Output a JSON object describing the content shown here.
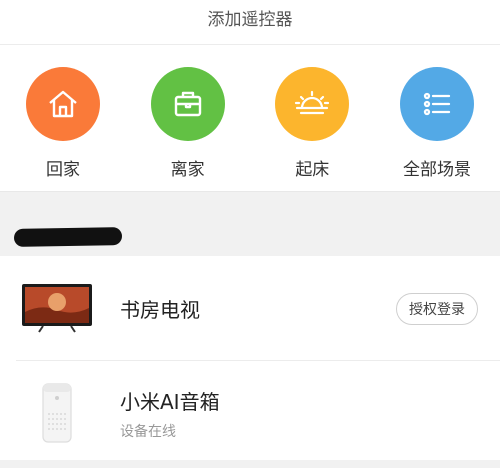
{
  "header": {
    "title": "添加遥控器"
  },
  "scenes": [
    {
      "label": "回家",
      "icon": "home-icon",
      "color": "#fa7a39"
    },
    {
      "label": "离家",
      "icon": "briefcase-icon",
      "color": "#62c144"
    },
    {
      "label": "起床",
      "icon": "sunrise-icon",
      "color": "#fcb52d"
    },
    {
      "label": "全部场景",
      "icon": "list-icon",
      "color": "#53a9e6"
    }
  ],
  "devices": [
    {
      "name": "书房电视",
      "action": "授权登录",
      "icon": "tv-icon"
    },
    {
      "name": "小米AI音箱",
      "status": "设备在线",
      "icon": "speaker-icon"
    }
  ]
}
